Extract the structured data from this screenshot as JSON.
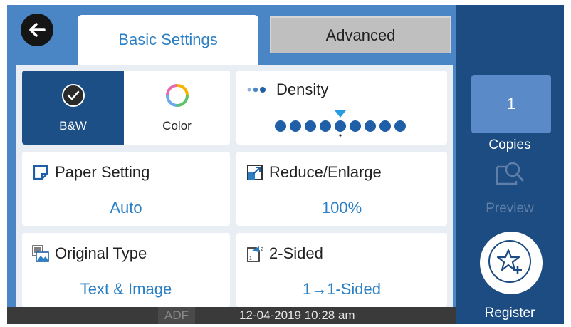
{
  "tabs": {
    "basic_label": "Basic Settings",
    "advanced_label": "Advanced"
  },
  "color_mode": {
    "bw_label": "B&W",
    "color_label": "Color",
    "selected": "B&W"
  },
  "density": {
    "title": "Density",
    "level": 5,
    "max_level": 9
  },
  "paper": {
    "title": "Paper Setting",
    "value": "Auto"
  },
  "reduce": {
    "title": "Reduce/Enlarge",
    "value": "100%"
  },
  "original": {
    "title": "Original Type",
    "value": "Text & Image"
  },
  "sided": {
    "title": "2-Sided",
    "value": "1→1-Sided"
  },
  "status": {
    "adf": "ADF",
    "datetime": "12-04-2019 10:28 am"
  },
  "copies": {
    "count": "1",
    "label": "Copies"
  },
  "preview": {
    "label": "Preview"
  },
  "register": {
    "label": "Register"
  },
  "colors": {
    "accent": "#2a7fc5",
    "selected_bg": "#1b4f86",
    "header_bg": "#4a86c5",
    "side_bg": "#1c4c82",
    "dot": "#1f5fa8"
  },
  "icons": [
    "back-arrow-icon",
    "check-icon",
    "color-wheel-icon",
    "density-dots-icon",
    "density-slider-marker-icon",
    "paper-icon",
    "reduce-enlarge-icon",
    "original-type-icon",
    "two-sided-icon",
    "preview-icon",
    "star-plus-icon"
  ]
}
